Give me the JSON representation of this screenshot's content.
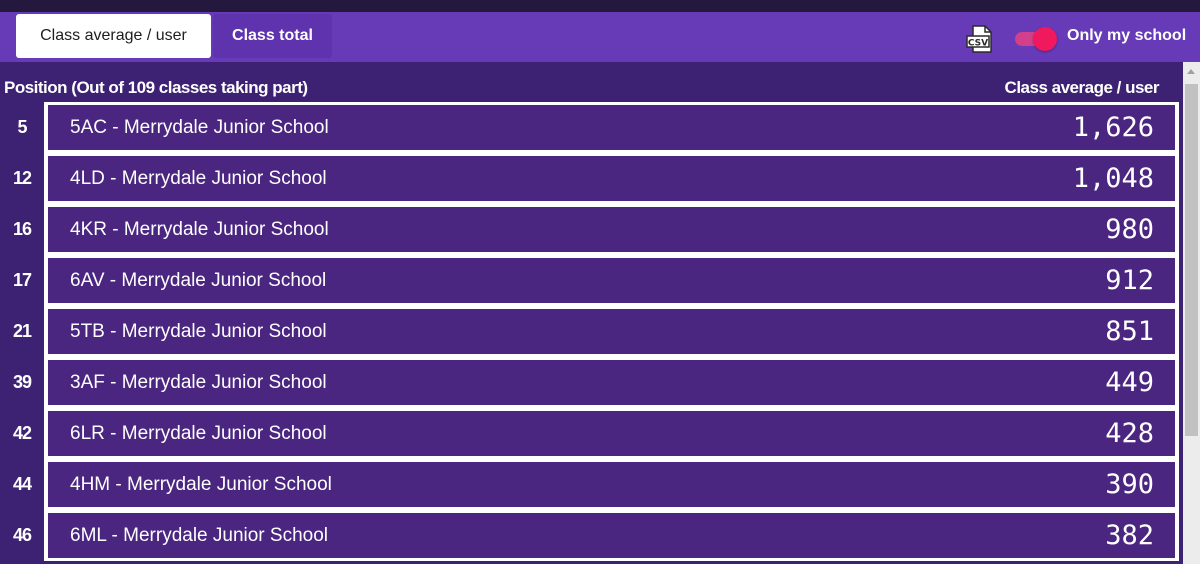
{
  "tabs": {
    "average_label": "Class average / user",
    "total_label": "Class total"
  },
  "toolbar": {
    "csv_icon_text": "CSV",
    "toggle_label": "Only my school",
    "toggle_on": true
  },
  "table": {
    "position_header": "Position (Out of 109 classes taking part)",
    "value_header": "Class average / user",
    "rows": [
      {
        "position": "5",
        "name": "5AC - Merrydale Junior School",
        "value": "1,626"
      },
      {
        "position": "12",
        "name": "4LD - Merrydale Junior School",
        "value": "1,048"
      },
      {
        "position": "16",
        "name": "4KR - Merrydale Junior School",
        "value": "980"
      },
      {
        "position": "17",
        "name": "6AV - Merrydale Junior School",
        "value": "912"
      },
      {
        "position": "21",
        "name": "5TB - Merrydale Junior School",
        "value": "851"
      },
      {
        "position": "39",
        "name": "3AF - Merrydale Junior School",
        "value": "449"
      },
      {
        "position": "42",
        "name": "6LR - Merrydale Junior School",
        "value": "428"
      },
      {
        "position": "44",
        "name": "4HM - Merrydale Junior School",
        "value": "390"
      },
      {
        "position": "46",
        "name": "6ML - Merrydale Junior School",
        "value": "382"
      }
    ]
  },
  "colors": {
    "toolbar": "#673ab8",
    "panel": "#3d2173",
    "row_fill": "#4a2680",
    "toggle_accent": "#f0195d"
  }
}
